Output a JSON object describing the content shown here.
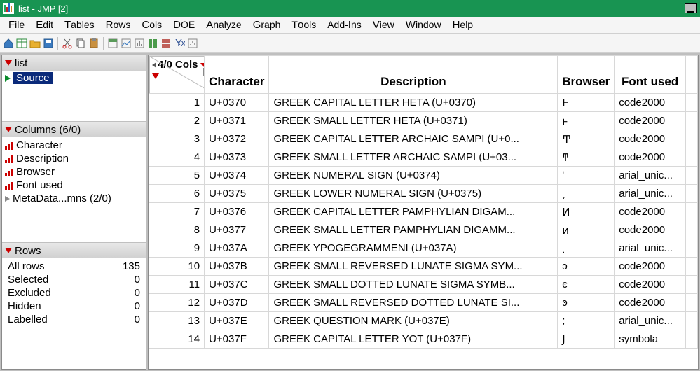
{
  "window": {
    "title": "list - JMP [2]"
  },
  "menus": [
    "File",
    "Edit",
    "Tables",
    "Rows",
    "Cols",
    "DOE",
    "Analyze",
    "Graph",
    "Tools",
    "Add-Ins",
    "View",
    "Window",
    "Help"
  ],
  "sidebar": {
    "table_name": "list",
    "source_label": "Source",
    "columns_header": "Columns (6/0)",
    "columns": [
      "Character",
      "Description",
      "Browser",
      "Font used",
      "MetaData...mns (2/0)"
    ],
    "rows_header": "Rows",
    "row_stats": [
      {
        "label": "All rows",
        "value": "135"
      },
      {
        "label": "Selected",
        "value": "0"
      },
      {
        "label": "Excluded",
        "value": "0"
      },
      {
        "label": "Hidden",
        "value": "0"
      },
      {
        "label": "Labelled",
        "value": "0"
      }
    ]
  },
  "grid": {
    "cols_indicator": "4/0 Cols",
    "headers": [
      "Character",
      "Description",
      "Browser",
      "Font used"
    ],
    "rows": [
      {
        "n": "1",
        "char": "U+0370",
        "desc": "GREEK CAPITAL LETTER HETA (U+0370)",
        "brow": "Ͱ",
        "font": "code2000"
      },
      {
        "n": "2",
        "char": "U+0371",
        "desc": "GREEK SMALL LETTER HETA (U+0371)",
        "brow": "ͱ",
        "font": "code2000"
      },
      {
        "n": "3",
        "char": "U+0372",
        "desc": "GREEK CAPITAL LETTER ARCHAIC SAMPI (U+0...",
        "brow": "Ͳ",
        "font": "code2000"
      },
      {
        "n": "4",
        "char": "U+0373",
        "desc": "GREEK SMALL LETTER ARCHAIC SAMPI (U+03...",
        "brow": "ͳ",
        "font": "code2000"
      },
      {
        "n": "5",
        "char": "U+0374",
        "desc": "GREEK NUMERAL SIGN (U+0374)",
        "brow": "ʹ",
        "font": "arial_unic..."
      },
      {
        "n": "6",
        "char": "U+0375",
        "desc": "GREEK LOWER NUMERAL SIGN (U+0375)",
        "brow": "͵",
        "font": "arial_unic..."
      },
      {
        "n": "7",
        "char": "U+0376",
        "desc": "GREEK CAPITAL LETTER PAMPHYLIAN DIGAM...",
        "brow": "Ͷ",
        "font": "code2000"
      },
      {
        "n": "8",
        "char": "U+0377",
        "desc": "GREEK SMALL LETTER PAMPHYLIAN DIGAMM...",
        "brow": "ͷ",
        "font": "code2000"
      },
      {
        "n": "9",
        "char": "U+037A",
        "desc": "GREEK YPOGEGRAMMENI (U+037A)",
        "brow": "ͺ",
        "font": "arial_unic..."
      },
      {
        "n": "10",
        "char": "U+037B",
        "desc": "GREEK SMALL REVERSED LUNATE SIGMA SYM...",
        "brow": "ͻ",
        "font": "code2000"
      },
      {
        "n": "11",
        "char": "U+037C",
        "desc": "GREEK SMALL DOTTED LUNATE SIGMA SYMB...",
        "brow": "ͼ",
        "font": "code2000"
      },
      {
        "n": "12",
        "char": "U+037D",
        "desc": "GREEK SMALL REVERSED DOTTED LUNATE SI...",
        "brow": "ͽ",
        "font": "code2000"
      },
      {
        "n": "13",
        "char": "U+037E",
        "desc": "GREEK QUESTION MARK (U+037E)",
        "brow": ";",
        "font": "arial_unic..."
      },
      {
        "n": "14",
        "char": "U+037F",
        "desc": "GREEK CAPITAL LETTER YOT (U+037F)",
        "brow": "Ϳ",
        "font": "symbola"
      }
    ]
  }
}
